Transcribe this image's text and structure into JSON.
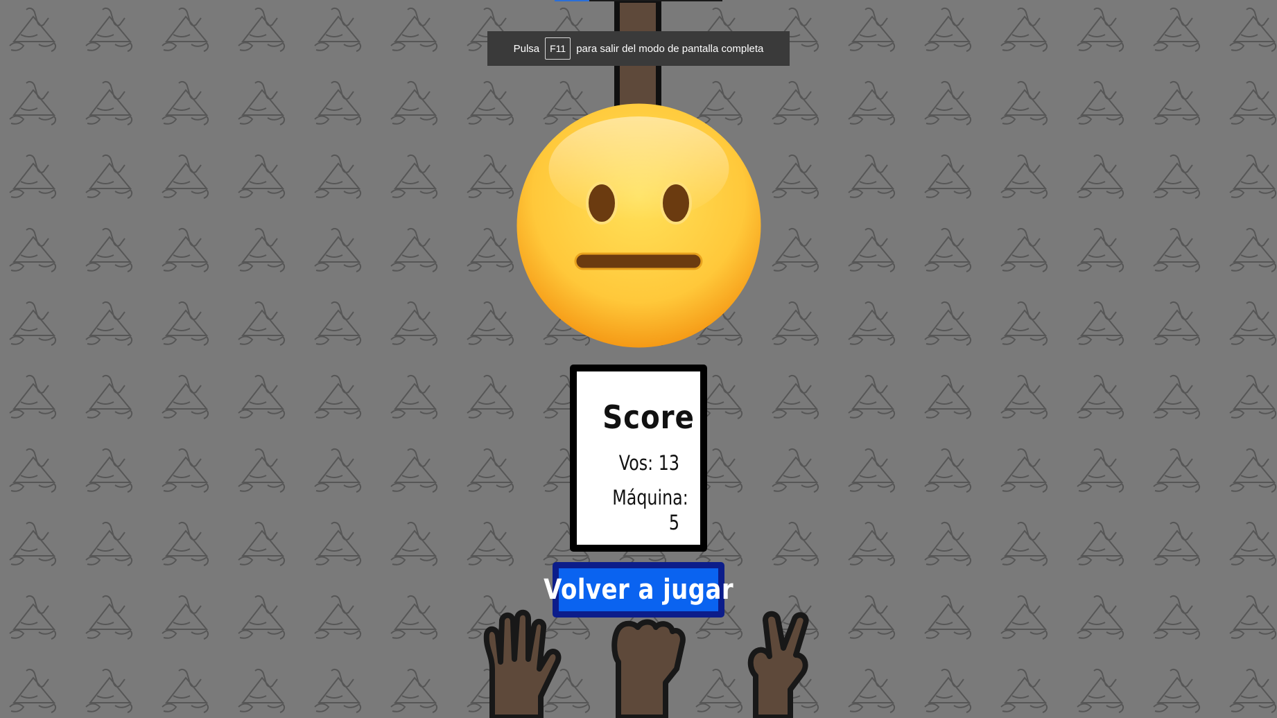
{
  "fullscreen_hint": {
    "prefix": "Pulsa",
    "key": "F11",
    "suffix": "para salir del modo de pantalla completa"
  },
  "result": {
    "emoji": "neutral-face",
    "outcome": "tie"
  },
  "score": {
    "title": "Score",
    "you_label": "Vos: 13",
    "machine_label": "Máquina: 5"
  },
  "replay_button": {
    "label": "Volver a jugar"
  },
  "choices": [
    "paper-hand",
    "rock-fist",
    "scissors-hand"
  ],
  "colors": {
    "button_fill": "#0a63f0",
    "button_border": "#0c1d8a",
    "emoji_yellow": "#ffc83a",
    "overlay": "rgba(0,0,0,0.52)"
  }
}
